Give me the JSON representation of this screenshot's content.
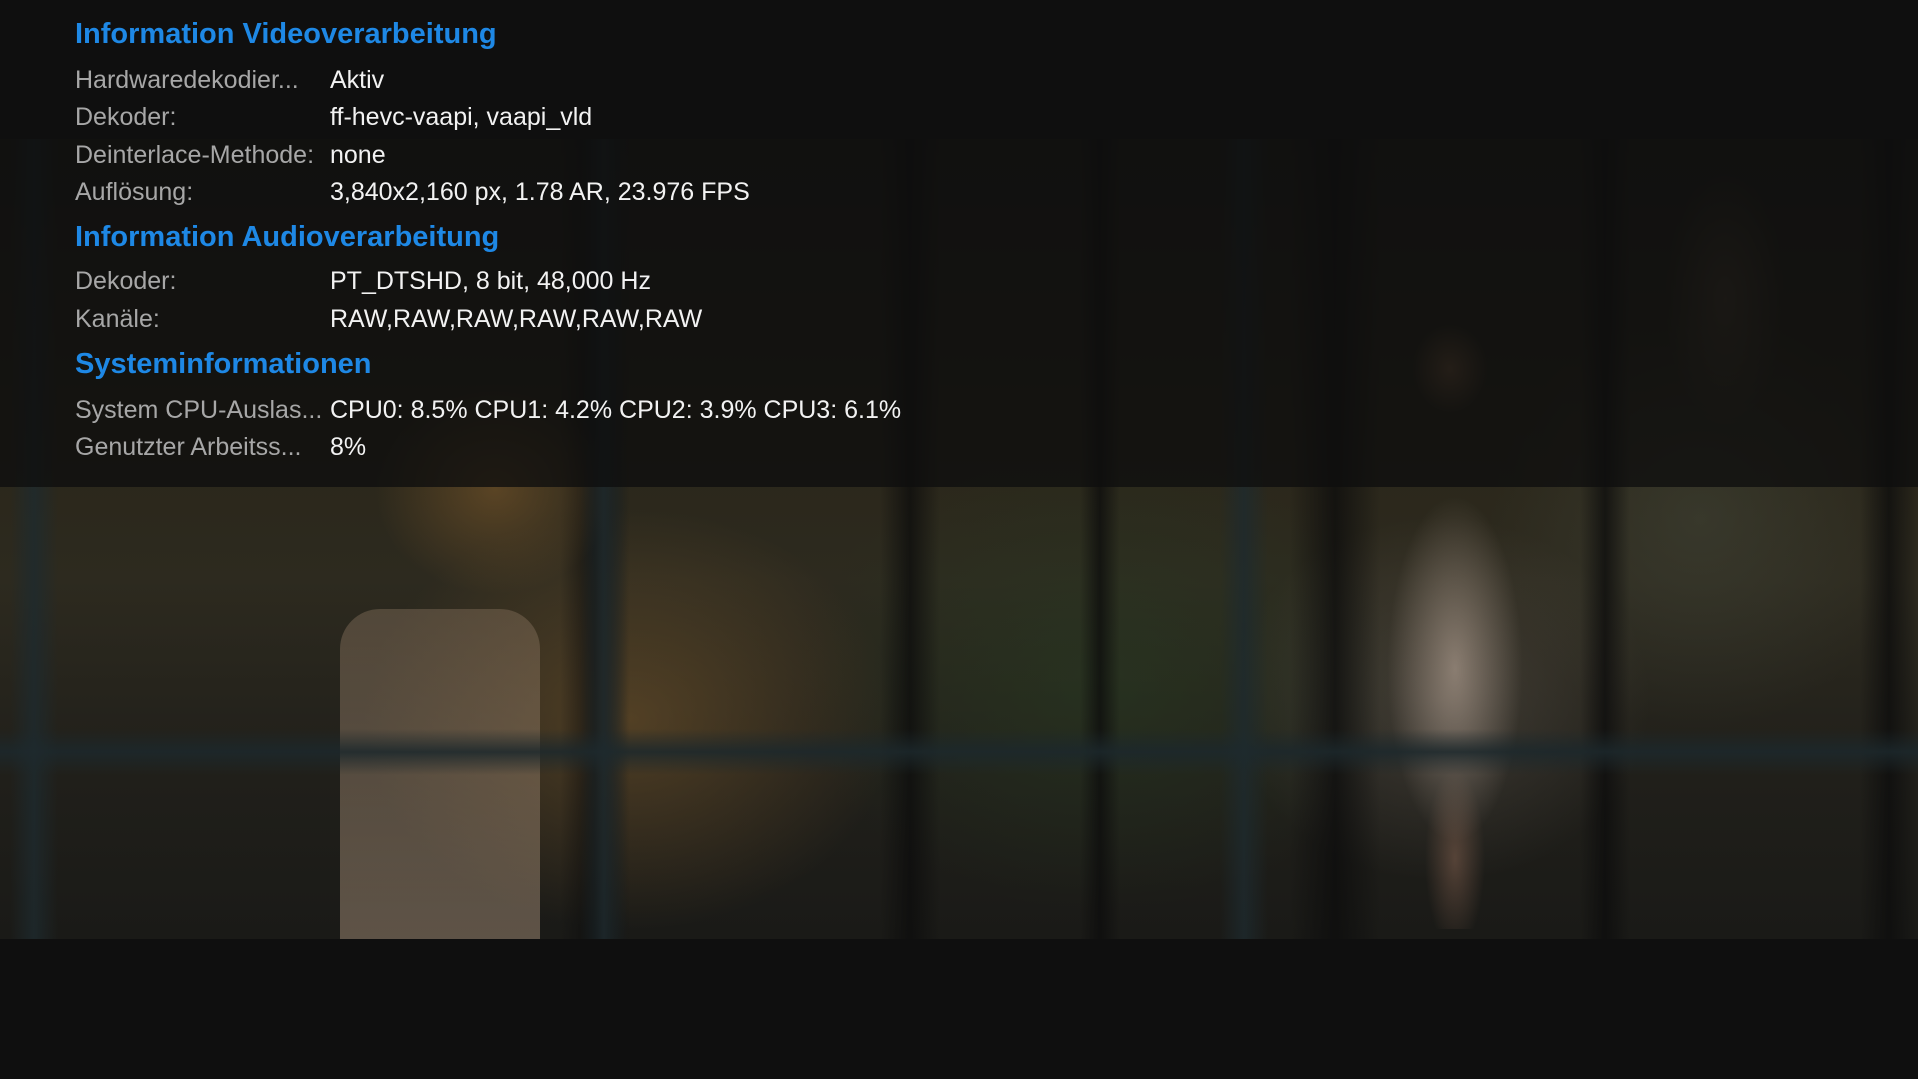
{
  "sections": [
    {
      "title": "Information Videoverarbeitung",
      "rows": [
        {
          "label": "Hardwaredekodier...",
          "value": "Aktiv"
        },
        {
          "label": "Dekoder:",
          "value": "ff-hevc-vaapi, vaapi_vld"
        },
        {
          "label": "Deinterlace-Methode:",
          "value": "none"
        },
        {
          "label": "Auflösung:",
          "value": "3,840x2,160 px, 1.78 AR, 23.976 FPS"
        }
      ]
    },
    {
      "title": "Information Audioverarbeitung",
      "rows": [
        {
          "label": "Dekoder:",
          "value": "PT_DTSHD, 8 bit, 48,000 Hz"
        },
        {
          "label": "Kanäle:",
          "value": "RAW,RAW,RAW,RAW,RAW,RAW"
        }
      ]
    },
    {
      "title": "Systeminformationen",
      "rows": [
        {
          "label": "System CPU-Auslas...",
          "value": "CPU0: 8.5% CPU1: 4.2% CPU2: 3.9% CPU3: 6.1%"
        },
        {
          "label": "Genutzter Arbeitss...",
          "value": "8%"
        }
      ]
    }
  ],
  "colors": {
    "section_title": "#1e88e5",
    "label": "#a7a7a7",
    "value": "#f2f2f2",
    "background": "#0f0f0f"
  }
}
